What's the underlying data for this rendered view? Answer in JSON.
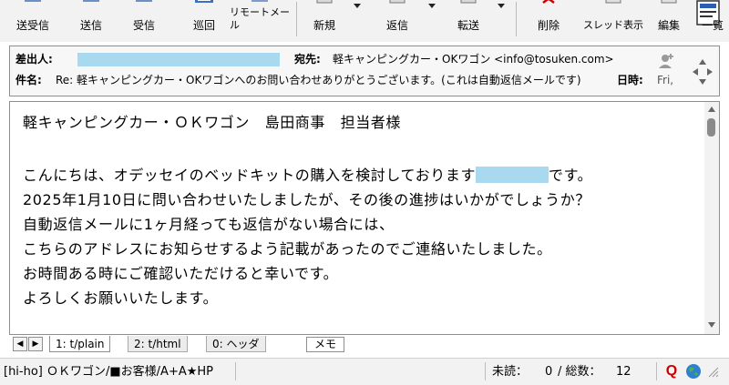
{
  "toolbar": {
    "buttons": [
      {
        "label": "送受信"
      },
      {
        "label": "送信"
      },
      {
        "label": "受信"
      },
      {
        "label": "巡回"
      },
      {
        "label": "リモートメール"
      },
      {
        "label": "新規"
      },
      {
        "label": "返信"
      },
      {
        "label": "転送"
      },
      {
        "label": "削除"
      },
      {
        "label": "スレッド表示"
      },
      {
        "label": "編集"
      },
      {
        "label": "一覧"
      }
    ]
  },
  "header": {
    "from_label": "差出人:",
    "to_label": "宛先:",
    "to_value": "軽キャンピングカー・OKワゴン <info@tosuken.com>",
    "subject_label": "件名:",
    "subject_value": "Re: 軽キャンピングカー・OKワゴンへのお問い合わせありがとうございます。(これは自動返信メールです)",
    "date_label": "日時:",
    "date_value": "Fri,"
  },
  "body": {
    "lines": [
      "軽キャンピングカー・ＯＫワゴン　島田商事　担当者様",
      "",
      "こんにちは、オデッセイのベッドキットの購入を検討しております",
      "2025年1月10日に問い合わせいたしましたが、その後の進捗はいかがでしょうか？",
      "自動返信メールに1ヶ月経っても返信がない場合には、",
      "こちらのアドレスにお知らせするよう記載があったのでご連絡いたしました。",
      "お時間ある時にご確認いただけると幸いです。",
      "よろしくお願いいたします。"
    ],
    "line2_suffix": "です。"
  },
  "tabs": {
    "items": [
      {
        "label": "1: t/plain"
      },
      {
        "label": "2: t/html"
      },
      {
        "label": "0: ヘッダ"
      }
    ],
    "memo_label": "メモ"
  },
  "status": {
    "folder": "[hi-ho] ＯＫワゴン/■お客様/A+A★HP",
    "unread_label": "未読：",
    "unread_count": "0",
    "total_label": "/ 総数：",
    "total_count": "12"
  },
  "colors": {
    "redaction": "#a8d9ee",
    "accent_red": "#cc0000"
  }
}
